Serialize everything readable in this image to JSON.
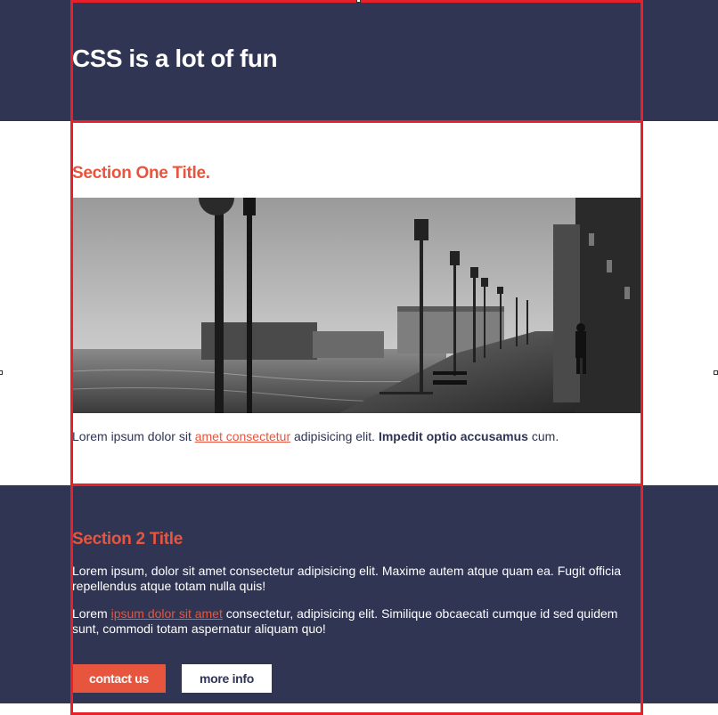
{
  "header": {
    "title": "CSS is a lot of fun"
  },
  "section_one": {
    "title": "Section One Title.",
    "image_alt": "foggy waterfront promenade with lamp posts",
    "text_before": "Lorem ipsum dolor sit ",
    "link_text": "amet consectetur",
    "text_middle": " adipisicing elit. ",
    "bold_text": "Impedit optio accusamus",
    "text_after": " cum."
  },
  "section_two": {
    "title": "Section 2 Title",
    "paragraph1": "Lorem ipsum, dolor sit amet consectetur adipisicing elit. Maxime autem atque quam ea. Fugit officia repellendus atque totam nulla quis!",
    "p2_before": "Lorem ",
    "p2_link": "ipsum dolor sit amet",
    "p2_after": " consectetur, adipisicing elit. Similique obcaecati cumque id sed quidem sunt, commodi totam aspernatur aliquam quo!",
    "buttons": {
      "primary": "contact us",
      "secondary": "more info"
    }
  },
  "colors": {
    "navy": "#2f3552",
    "accent": "#e8553e",
    "outline": "#e8202a"
  }
}
